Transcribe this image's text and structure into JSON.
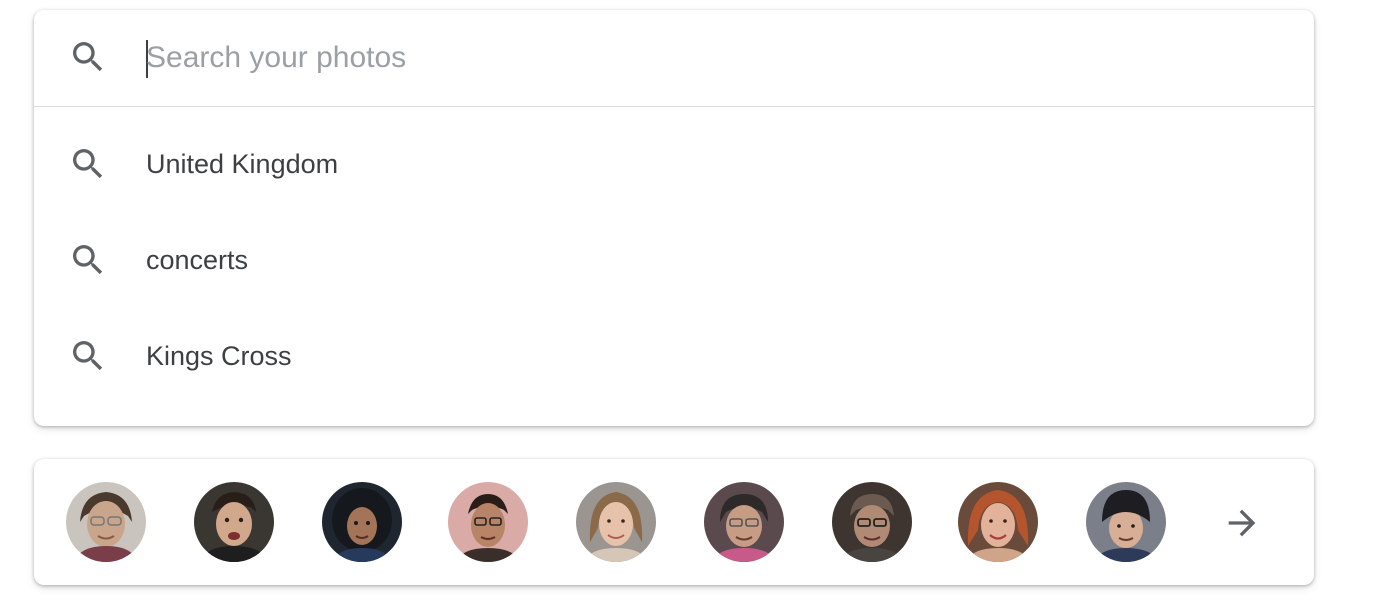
{
  "search": {
    "placeholder": "Search your photos",
    "value": ""
  },
  "suggestions": [
    {
      "label": "United Kingdom",
      "icon": "search-icon"
    },
    {
      "label": "concerts",
      "icon": "search-icon"
    },
    {
      "label": "Kings Cross",
      "icon": "search-icon"
    }
  ],
  "people": {
    "count_visible": 9,
    "next_icon": "arrow-right-icon"
  },
  "colors": {
    "text": "#3c4043",
    "placeholder": "#9aa0a6",
    "icon": "#5f6368",
    "divider": "#dadce0"
  }
}
